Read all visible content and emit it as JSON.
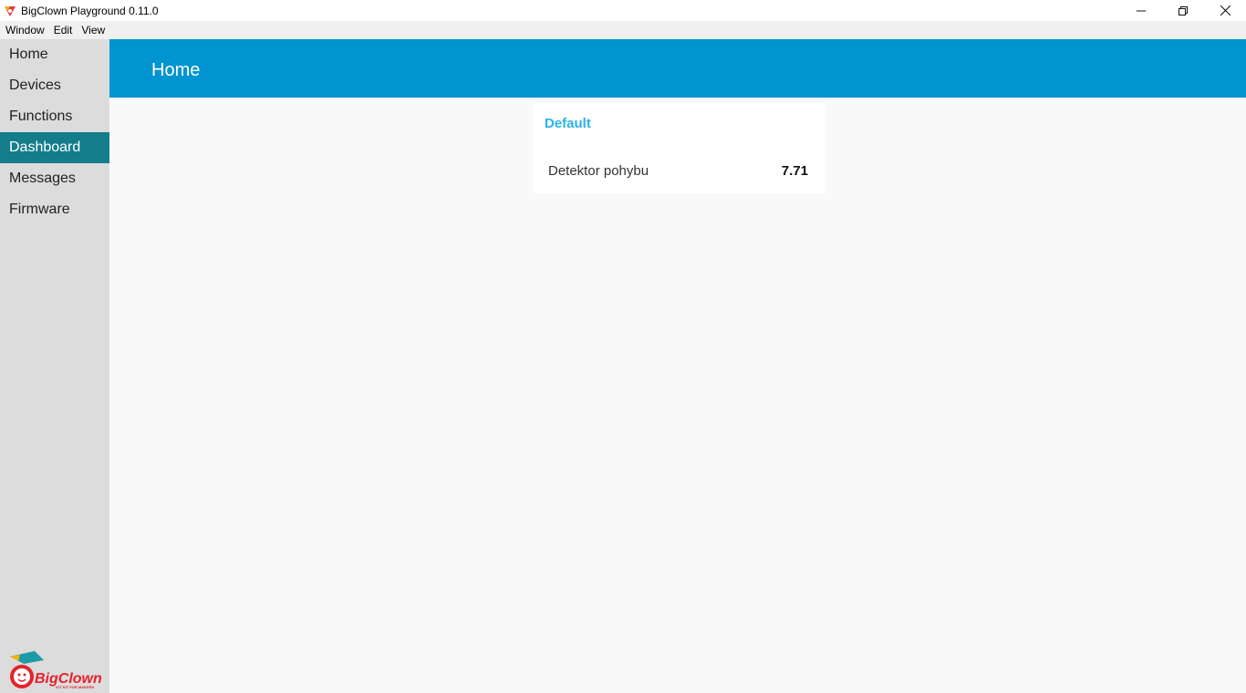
{
  "window": {
    "title": "BigClown Playground 0.11.0",
    "controls": {
      "minimize": "—",
      "restore": "❐",
      "close": "✕"
    }
  },
  "menu": [
    "Window",
    "Edit",
    "View"
  ],
  "sidebar": {
    "items": [
      {
        "label": "Home",
        "active": false
      },
      {
        "label": "Devices",
        "active": false
      },
      {
        "label": "Functions",
        "active": false
      },
      {
        "label": "Dashboard",
        "active": true
      },
      {
        "label": "Messages",
        "active": false
      },
      {
        "label": "Firmware",
        "active": false
      }
    ],
    "logo_text": "BigClown",
    "logo_tagline": "IOT KIT FOR MAKERS"
  },
  "header": {
    "title": "Home"
  },
  "dashboard": {
    "card_title": "Default",
    "rows": [
      {
        "label": "Detektor pohybu",
        "value": "7.71"
      }
    ]
  },
  "colors": {
    "header": "#0094d0",
    "sidebar": "#dcdcdc",
    "active_nav": "#137d8a",
    "card_title": "#29b3e6",
    "content_bg": "#f9f9f9"
  }
}
